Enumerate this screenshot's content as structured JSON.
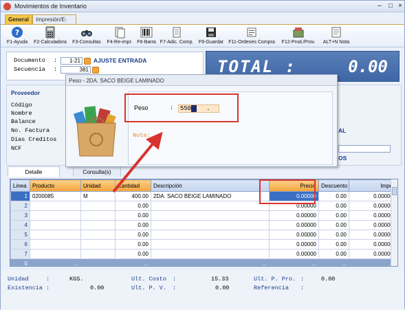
{
  "window": {
    "title": "Movimientos de Inventario"
  },
  "tabs": [
    {
      "label": "General"
    },
    {
      "label": "Impresión/E-mail"
    }
  ],
  "toolbar": [
    {
      "label": "F1-Ayuda",
      "icon": "help-icon"
    },
    {
      "label": "F2-Calculadora",
      "icon": "calculator-icon"
    },
    {
      "label": "F3-Consultas",
      "icon": "binoculars-icon"
    },
    {
      "label": "F4-Re-impr.",
      "icon": "reprint-icon"
    },
    {
      "label": "F6-Barra",
      "icon": "barcode-icon"
    },
    {
      "label": "F7-Adic. Comp.",
      "icon": "add-component-icon"
    },
    {
      "label": "F9-Guardar",
      "icon": "save-icon"
    },
    {
      "label": "F11-Ordenes Compra",
      "icon": "purchase-orders-icon"
    },
    {
      "label": "F12-Prod./Prov.",
      "icon": "products-icon"
    },
    {
      "label": "ALT+N Nota",
      "icon": "note-icon"
    }
  ],
  "header": {
    "documento_label": "Documento",
    "documento_value": "1-21",
    "documento_type": "AJUSTE ENTRADA",
    "secuencia_label": "Secuencia",
    "secuencia_value": "381",
    "colon": ":"
  },
  "total": {
    "label": "TOTAL :",
    "value": "0.00"
  },
  "proveedor": {
    "section": "Proveedor",
    "fields": [
      "Código",
      "Nombre",
      "Balance",
      "No. Factura",
      "Dias Creditos",
      "NCF"
    ],
    "al_suffix": "AL",
    "os_suffix": "OS"
  },
  "popup": {
    "title": "Peso - 2DA. SACO BEIGE LAMINADO",
    "peso_label": "Peso",
    "colon": ":",
    "peso_value": "550",
    "peso_decimal": ".",
    "nota_label": "Nota:"
  },
  "grid_tabs": [
    {
      "label": "Detalle"
    },
    {
      "label": "Consulta(s)"
    }
  ],
  "grid": {
    "columns": [
      "Linea",
      "Producto",
      "Unidad",
      "Cantidad",
      "Descripción",
      "Precio",
      "Descuento",
      "Impo"
    ],
    "rows": [
      {
        "linea": "1",
        "producto": "0200085",
        "unidad": "M",
        "cantidad": "400.00",
        "descripcion": "2DA. SACO BEIGE LAMINADO",
        "precio": "0.00000",
        "descuento": "0.00",
        "importe": "0.00000"
      },
      {
        "linea": "2",
        "producto": "",
        "unidad": "",
        "cantidad": "0.00",
        "descripcion": "",
        "precio": "0.00000",
        "descuento": "0.00",
        "importe": "0.00000"
      },
      {
        "linea": "3",
        "producto": "",
        "unidad": "",
        "cantidad": "0.00",
        "descripcion": "",
        "precio": "0.00000",
        "descuento": "0.00",
        "importe": "0.00000"
      },
      {
        "linea": "4",
        "producto": "",
        "unidad": "",
        "cantidad": "0.00",
        "descripcion": "",
        "precio": "0.00000",
        "descuento": "0.00",
        "importe": "0.00000"
      },
      {
        "linea": "5",
        "producto": "",
        "unidad": "",
        "cantidad": "0.00",
        "descripcion": "",
        "precio": "0.00000",
        "descuento": "0.00",
        "importe": "0.00000"
      },
      {
        "linea": "6",
        "producto": "",
        "unidad": "",
        "cantidad": "0.00",
        "descripcion": "",
        "precio": "0.00000",
        "descuento": "0.00",
        "importe": "0.00000"
      },
      {
        "linea": "7",
        "producto": "",
        "unidad": "",
        "cantidad": "0.00",
        "descripcion": "",
        "precio": "0.00000",
        "descuento": "0.00",
        "importe": "0.00000"
      }
    ],
    "totals": {
      "linea": "0",
      "producto": "...",
      "cantidad": "...",
      "descripcion": "...",
      "precio": "...",
      "descuento": "...",
      "importe": "..."
    }
  },
  "footer": {
    "unidad_label": "Unidad",
    "unidad_value": "KGS.",
    "existencia_label": "Existencia",
    "existencia_value": "0.00",
    "ult_costo_label": "Ult. Costo",
    "ult_costo_value": "15.33",
    "ult_pv_label": "Ult. P. V.",
    "ult_pv_value": "0.00",
    "ult_pprov_label": "Ult. P. Pro.",
    "ult_pprov_value": "0.00",
    "referencia_label": "Referencia",
    "colon": ":"
  },
  "colors": {
    "accent": "#f3a53a",
    "total_bg": "#3e66a6",
    "highlight": "#d8332e",
    "selection": "#3b6fc4"
  }
}
